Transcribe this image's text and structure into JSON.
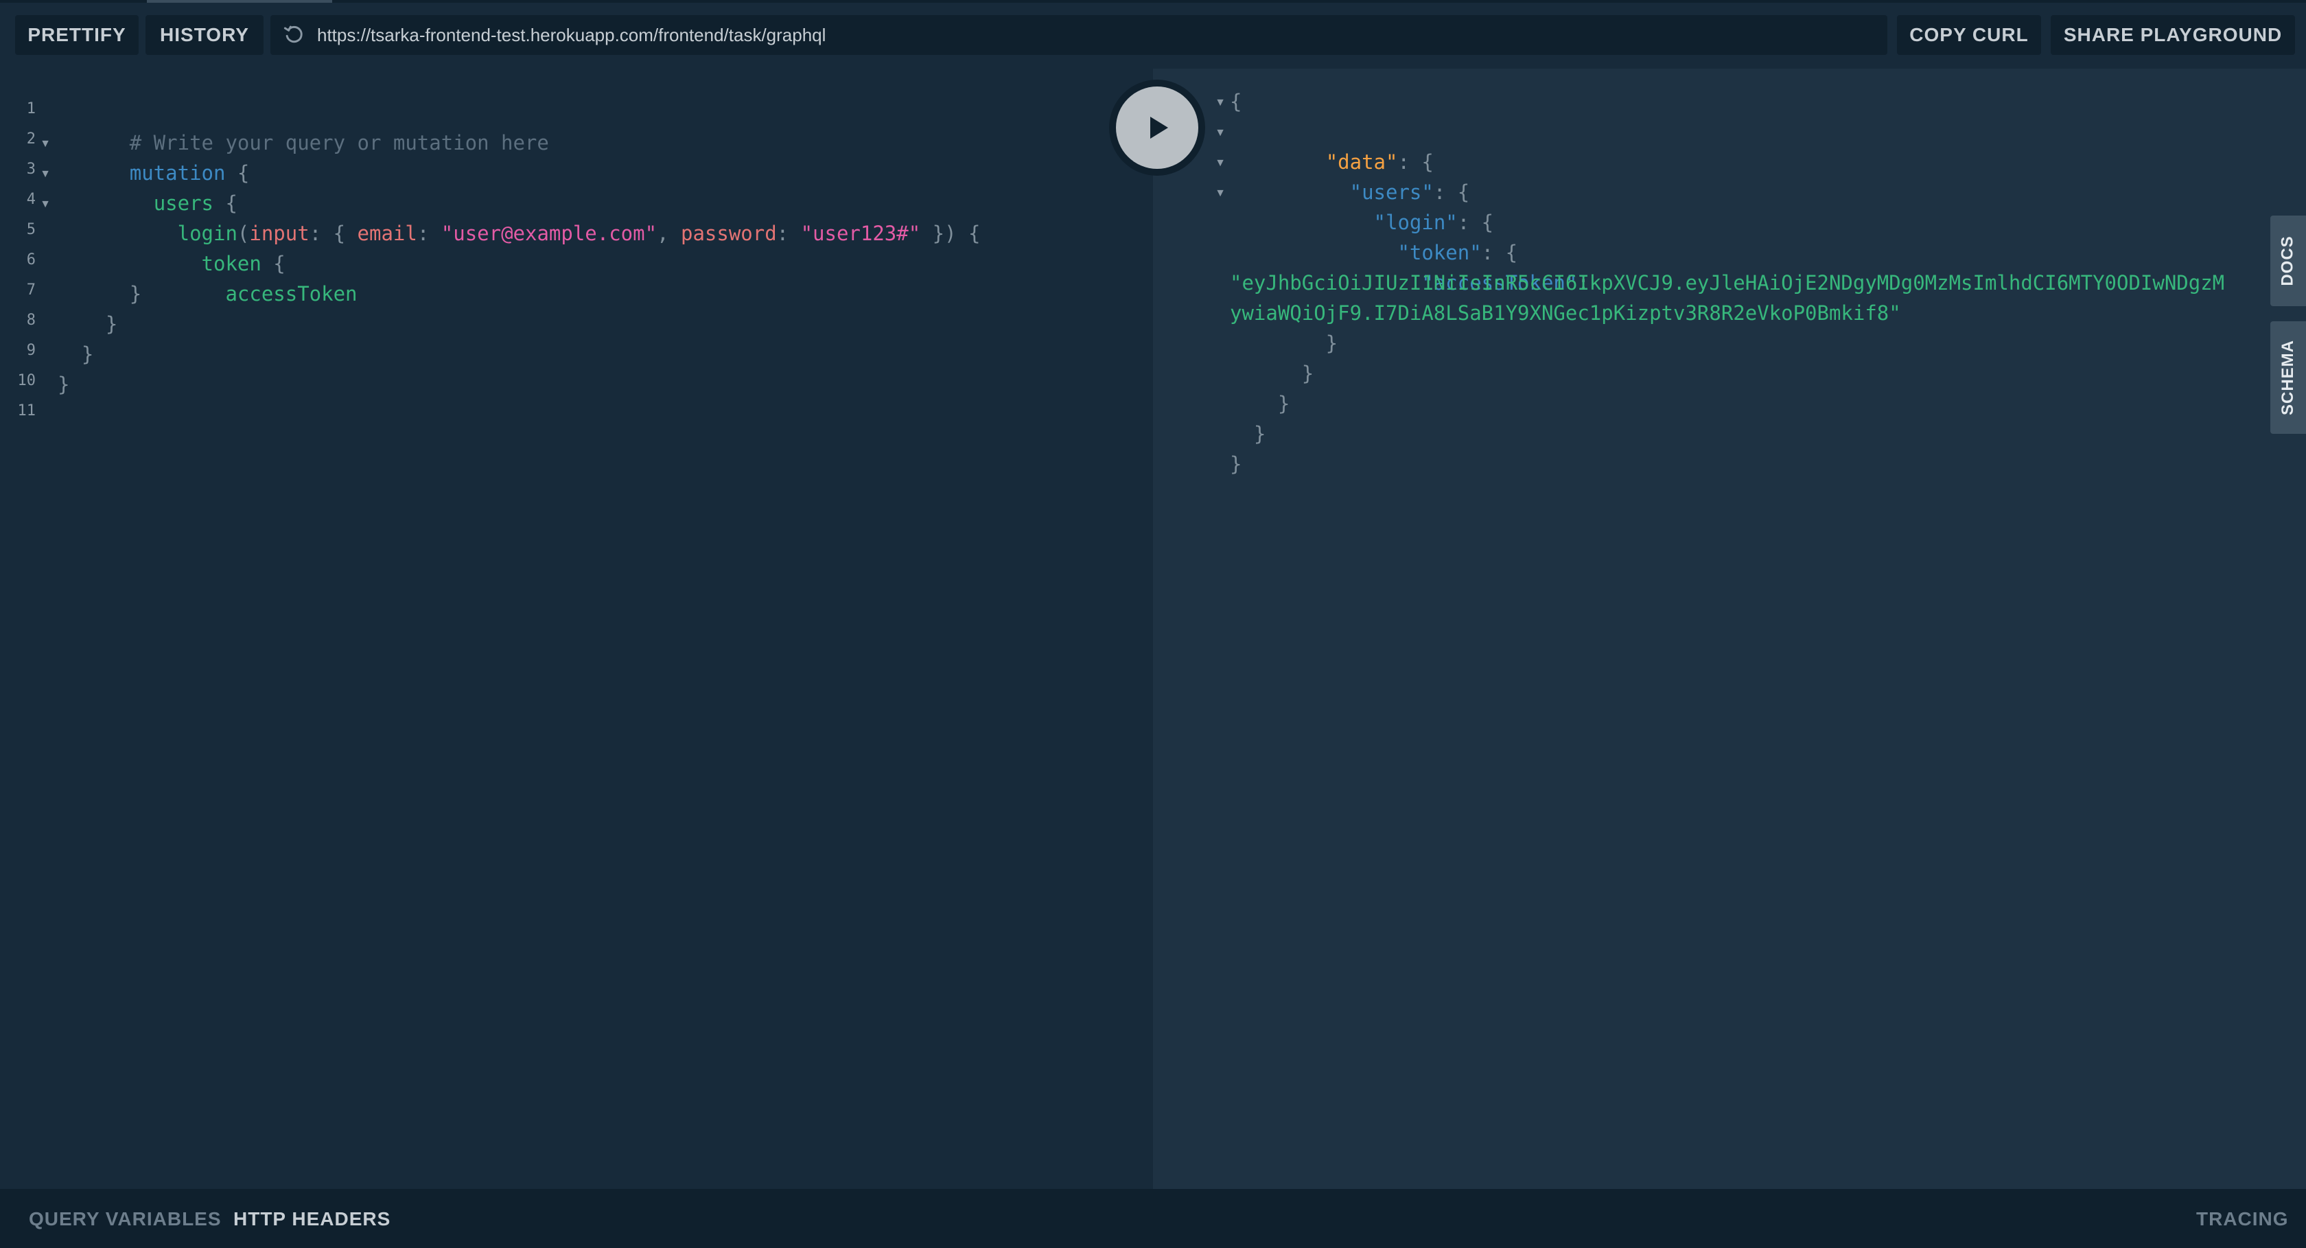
{
  "toolbar": {
    "prettify_label": "PRETTIFY",
    "history_label": "HISTORY",
    "endpoint_url": "https://tsarka-frontend-test.herokuapp.com/frontend/task/graphql",
    "copy_curl_label": "COPY CURL",
    "share_label": "SHARE PLAYGROUND"
  },
  "query_editor": {
    "line_numbers": [
      "1",
      "2",
      "3",
      "4",
      "5",
      "6",
      "7",
      "8",
      "9",
      "10",
      "11"
    ],
    "comment": "# Write your query or mutation here",
    "mutation_kw": "mutation",
    "users_field": "users",
    "login_field": "login",
    "input_arg": "input",
    "email_arg": "email",
    "email_value": "\"user@example.com\"",
    "password_arg": "password",
    "password_value": "\"user123#\"",
    "token_field": "token",
    "access_token_field": "accessToken"
  },
  "result": {
    "key_data": "\"data\"",
    "key_users": "\"users\"",
    "key_login": "\"login\"",
    "key_token": "\"token\"",
    "key_access_token": "\"accessToken\"",
    "access_token_line1": "\"eyJhbGciOiJIUzI1NiIsInR5cCI6IkpXVCJ9.eyJleHAiOjE2NDgyMDg0MzMsImlhdCI6MTY0ODIwNDgzM",
    "access_token_line2": "ywiaWQiOjF9.I7DiA8LSaB1Y9XNGec1pKizptv3R8R2eVkoP0Bmkif8\""
  },
  "side_tabs": {
    "docs_label": "DOCS",
    "schema_label": "SCHEMA"
  },
  "bottom_bar": {
    "query_variables_label": "QUERY VARIABLES",
    "http_headers_label": "HTTP HEADERS",
    "tracing_label": "TRACING"
  },
  "icons": {
    "reload": "reload-icon",
    "play": "play-icon",
    "fold": "fold-arrow-icon"
  },
  "colors": {
    "background": "#172a3a",
    "result_background": "#1e3243",
    "toolbar_button": "#0f202d",
    "keyword": "#3d8ac4",
    "field": "#37b77c",
    "argument": "#e37474",
    "string": "#e35ba5",
    "data_key": "#f5a142"
  }
}
